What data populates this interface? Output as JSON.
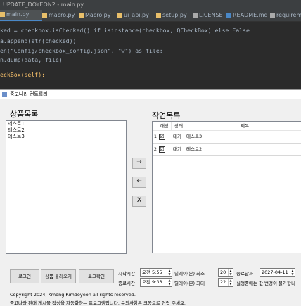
{
  "ide": {
    "title": "UPDATE_DOYEON2 - main.py",
    "tabs": [
      "main.py",
      "macro.py",
      "Macro.py",
      "ui_api.py",
      "setup.py",
      "LICENSE",
      "README.md",
      "requireme"
    ],
    "code_lines": [
      [
        "",
        "",
        "",
        "ked = checkbox.isChecked() if isinstance(checkbox, QCheckBox) else False"
      ],
      [
        "",
        "",
        "",
        "a.append(str(checked))"
      ],
      [
        "",
        "",
        "",
        ""
      ],
      [
        "",
        "en(\"Config/checkbox_config.json\", \"w\") as file:",
        "",
        ""
      ],
      [
        "",
        "",
        "",
        "n.dump(data, file)"
      ],
      [
        "",
        "",
        "",
        ""
      ],
      [
        "",
        "",
        "",
        "eckBox(self):"
      ]
    ]
  },
  "window": {
    "title": "중고나라 컨트롤러",
    "product_list": {
      "label": "상품목록",
      "items": [
        "테스트1",
        "테스트2",
        "테스트3"
      ]
    },
    "job_list": {
      "label": "작업목록",
      "columns": [
        "대상",
        "상태",
        "제목"
      ],
      "rows": [
        {
          "num": "1",
          "checked": "☑",
          "status": "대기",
          "title": "테스트3"
        },
        {
          "num": "2",
          "checked": "☑",
          "status": "대기",
          "title": "테스트2"
        }
      ]
    },
    "buttons": {
      "add": "→",
      "remove": "←",
      "clear": "X",
      "login": "로그인",
      "load_products": "상품 불러오기",
      "login_check": "로그확인"
    },
    "settings": {
      "start_time_label": "시작시간",
      "start_time": "오전 5:55",
      "end_time_label": "종료시간",
      "end_time": "오전 9:33",
      "delay_min_label": "딜레이(분) 최소",
      "delay_min": "20",
      "delay_max_label": "딜레이(분) 최대",
      "delay_max": "22",
      "end_date_label": "종료날짜",
      "end_date": "2027-04-11",
      "note": "실행중에는 값 변경이 불가합니"
    },
    "footer": {
      "copyright": "Copyright 2024, Kmong.Kimdoyeon all rights reserved.",
      "line2": "중고나라 판매 게시물 작성을 자동화하는 프로그램입니다. 문의사항은 크몽으로 연락 주세요."
    }
  }
}
